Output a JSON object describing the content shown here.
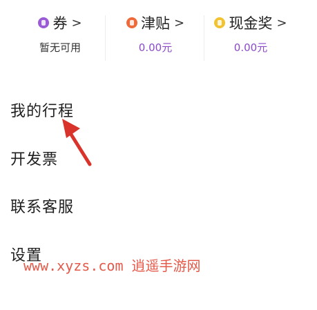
{
  "stats": [
    {
      "label": "券",
      "value": "暂无可用",
      "icon": "coupon-icon",
      "icon_color": "#9b5bd6"
    },
    {
      "label": "津贴",
      "value": "0.00元",
      "icon": "subsidy-icon",
      "icon_color": "#ef6a3a"
    },
    {
      "label": "现金奖",
      "value": "0.00元",
      "icon": "cash-reward-icon",
      "icon_color": "#f2c231"
    }
  ],
  "chevron": ">",
  "menu": {
    "trips": "我的行程",
    "invoice": "开发票",
    "contact": "联系客服",
    "settings": "设置"
  },
  "watermark": "www.xyzs.com 逍遥手游网",
  "colors": {
    "accent_purple": "#8b4ac9",
    "annotation_red": "#d9342b",
    "watermark_red": "#e35a4a"
  }
}
